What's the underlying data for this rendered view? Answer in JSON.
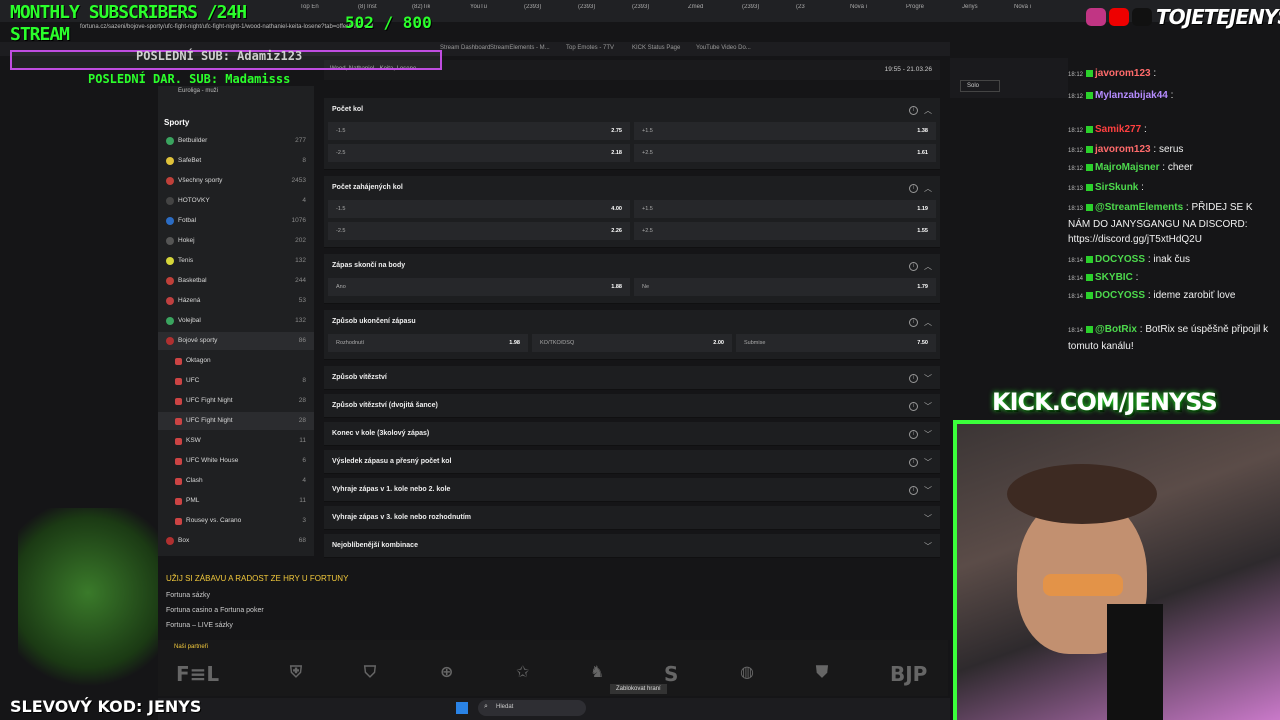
{
  "overlay": {
    "monthly": "MONTHLY SUBSCRIBERS /24H",
    "stream": "STREAM",
    "count": "502 / 800",
    "last_sub": "POSLEDNÍ SUB: Adamiz123",
    "last_donation": "POSLEDNÍ DAR. SUB: Madamisss",
    "social": "TOJETEJENYS",
    "kick": "KICK.COM/JENYSS",
    "promo": "SLEVOVÝ KOD: JENYS"
  },
  "browser": {
    "tabs": [
      "Top En",
      "(8) Inst",
      "(82)Tik",
      "YouTu",
      "(2393)",
      "(2393)",
      "(2393)",
      "Zmed",
      "(2393)",
      "(23",
      "Nová i",
      "Progre",
      "Jenys",
      "Nová i"
    ],
    "url": "fortuna.cz/sazeni/bojove-sporty/ufc-fight-night/ufc-fight-night-1/wood-nathaniel-keita-losene?tab=offer&filter=all",
    "bookmarks": [
      "Stream Dashboard",
      "StreamElements - M...",
      "Top Emotes - 7TV",
      "KICK Status Page",
      "YouTube Video Do..."
    ]
  },
  "match": {
    "name": "Wood, Nathaniel - Keita, Losene",
    "time": "19:55 - 21.03.26"
  },
  "sidebar": {
    "top": "Euroliga - muži",
    "heading": "Sporty",
    "items": [
      {
        "label": "Betbuilder",
        "count": "277"
      },
      {
        "label": "SafeBet",
        "count": "8"
      },
      {
        "label": "Všechny sporty",
        "count": "2453"
      },
      {
        "label": "HOTOVKY",
        "count": "4"
      },
      {
        "label": "Fotbal",
        "count": "1076"
      },
      {
        "label": "Hokej",
        "count": "202"
      },
      {
        "label": "Tenis",
        "count": "132"
      },
      {
        "label": "Basketbal",
        "count": "244"
      },
      {
        "label": "Házená",
        "count": "53"
      },
      {
        "label": "Volejbal",
        "count": "132"
      },
      {
        "label": "Bojové sporty",
        "count": "86"
      }
    ],
    "sub_items": [
      {
        "label": "Oktagon",
        "count": ""
      },
      {
        "label": "UFC",
        "count": "8"
      },
      {
        "label": "UFC Fight Night",
        "count": "28"
      },
      {
        "label": "UFC Fight Night",
        "count": "28"
      },
      {
        "label": "KSW",
        "count": "11"
      },
      {
        "label": "UFC White House",
        "count": "6"
      },
      {
        "label": "Clash",
        "count": "4"
      },
      {
        "label": "PML",
        "count": "11"
      },
      {
        "label": "Rousey vs. Carano",
        "count": "3"
      }
    ],
    "last": {
      "label": "Box",
      "count": "68"
    }
  },
  "markets": [
    {
      "title": "Počet kol",
      "odds": [
        [
          "-1.5",
          "2.75"
        ],
        [
          "+1.5",
          "1.38"
        ],
        [
          "-2.5",
          "2.18"
        ],
        [
          "+2.5",
          "1.61"
        ]
      ]
    },
    {
      "title": "Počet zahájených kol",
      "odds": [
        [
          "-1.5",
          "4.00"
        ],
        [
          "+1.5",
          "1.19"
        ],
        [
          "-2.5",
          "2.26"
        ],
        [
          "+2.5",
          "1.55"
        ]
      ]
    },
    {
      "title": "Zápas skončí na body",
      "odds": [
        [
          "Ano",
          "1.88"
        ],
        [
          "Ne",
          "1.79"
        ]
      ]
    },
    {
      "title": "Způsob ukončení zápasu",
      "odds": [
        [
          "Rozhodnutí",
          "1.98"
        ],
        [
          "KO/TKO/DSQ",
          "2.00"
        ],
        [
          "Submise",
          "7.50"
        ]
      ]
    }
  ],
  "collapsed_markets": [
    "Způsob vítězství",
    "Způsob vítězství (dvojitá šance)",
    "Konec v kole (3kolový zápas)",
    "Výsledek zápasu a přesný počet kol",
    "Vyhraje zápas v 1. kole nebo 2. kole",
    "Vyhraje zápas v 3. kole nebo rozhodnutím",
    "Nejoblíbenější kombinace"
  ],
  "footer": {
    "heading": "UŽIJ SI ZÁBAVU A RADOST ZE HRY U FORTUNY",
    "links": [
      "Fortuna sázky",
      "Fortuna casino a Fortuna poker",
      "Fortuna – LIVE sázky"
    ],
    "partners_label": "Naši partneři",
    "partners": [
      "F≡L",
      "BJP"
    ]
  },
  "taskbar": {
    "search_placeholder": "Hledat",
    "tooltip": "Zablokovat hraní"
  },
  "chat": {
    "messages": [
      {
        "time": "18:12",
        "user": "javorom123",
        "text": ":",
        "color": "#ff6b6b"
      },
      {
        "time": "18:12",
        "user": "Mylanzabijak44",
        "text": ":",
        "color": "#b58cff"
      },
      {
        "time": "18:12",
        "user": "Samik277",
        "text": ":",
        "color": "#ff4040"
      },
      {
        "time": "18:12",
        "user": "javorom123",
        "text": ": serus",
        "color": "#ff6b6b"
      },
      {
        "time": "18:12",
        "user": "MajroMajsner",
        "text": ": cheer",
        "color": "#4dd94d"
      },
      {
        "time": "18:13",
        "user": "SirSkunk",
        "text": ":",
        "color": "#4dd94d"
      },
      {
        "time": "18:13",
        "user": "@StreamElements",
        "text": ": PŘIDEJ SE K NÁM DO JANYSGANGU NA DISCORD: https://discord.gg/jT5xtHdQ2U",
        "color": "#4dd94d"
      },
      {
        "time": "18:14",
        "user": "DOCYOSS",
        "text": ": inak čus",
        "color": "#4dd94d"
      },
      {
        "time": "18:14",
        "user": "SKYBIC",
        "text": ":",
        "color": "#4dd94d"
      },
      {
        "time": "18:14",
        "user": "DOCYOSS",
        "text": ": ideme zarobiť love",
        "color": "#4dd94d"
      },
      {
        "time": "18:14",
        "user": "@BotRix",
        "text": ": BotRix se úspěšně připojil k tomuto kanálu!",
        "color": "#4dd94d"
      }
    ]
  },
  "colors": {
    "accent": "#2bff2b",
    "gold": "#f2c93c",
    "panel": "#1d1e20"
  }
}
